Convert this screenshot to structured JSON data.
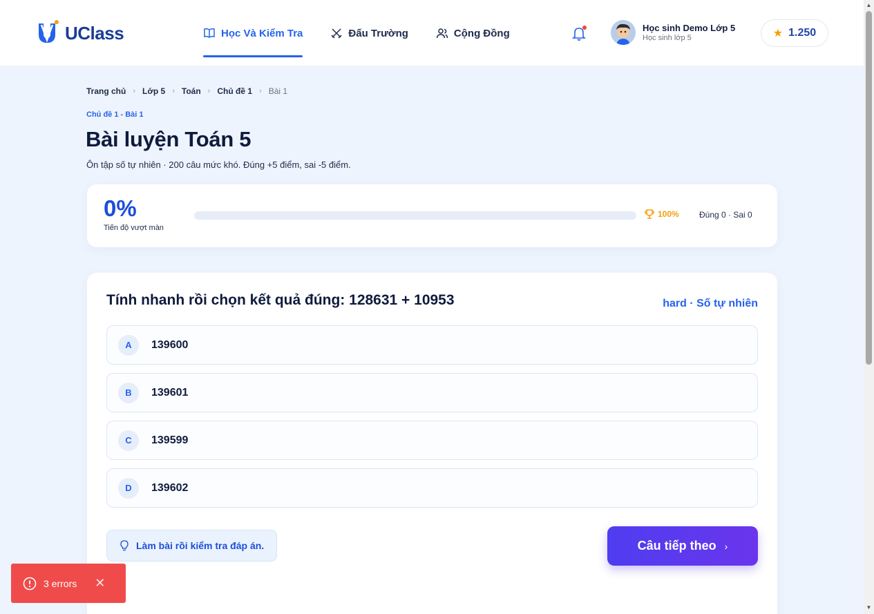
{
  "header": {
    "logo_text": "UClass",
    "nav": [
      {
        "label": "Học Và Kiểm Tra",
        "icon": "book-icon",
        "active": true
      },
      {
        "label": "Đấu Trường",
        "icon": "swords-icon",
        "active": false
      },
      {
        "label": "Cộng Đồng",
        "icon": "users-icon",
        "active": false
      }
    ],
    "user": {
      "name": "Học sinh Demo Lớp 5",
      "role": "Học sinh lớp 5"
    },
    "points": "1.250"
  },
  "breadcrumb": [
    "Trang chủ",
    "Lớp 5",
    "Toán",
    "Chủ đề 1",
    "Bài 1"
  ],
  "page": {
    "kicker": "Chủ đề 1 - Bài 1",
    "title": "Bài luyện Toán 5",
    "subtitle": "Ôn tập số tự nhiên · 200 câu mức khó. Đúng +5 điểm, sai -5 điểm."
  },
  "progress": {
    "percent_label": "0%",
    "label": "Tiến độ vượt màn",
    "value_fraction": 0,
    "goal": "100%",
    "score": "Đúng 0 · Sai 0"
  },
  "question": {
    "text": "Tính nhanh rồi chọn kết quả đúng: 128631 + 10953",
    "meta": "hard · Số tự nhiên",
    "options": [
      {
        "letter": "A",
        "value": "139600"
      },
      {
        "letter": "B",
        "value": "139601"
      },
      {
        "letter": "C",
        "value": "139599"
      },
      {
        "letter": "D",
        "value": "139602"
      }
    ],
    "hint": "Làm bài rồi kiểm tra đáp án.",
    "next_label": "Câu tiếp theo"
  },
  "error_toast": {
    "label": "3 errors"
  },
  "colors": {
    "primary": "#2563eb",
    "accent_purple": "#5b3aee",
    "error": "#f04b4b",
    "gold": "#f59e0b"
  }
}
